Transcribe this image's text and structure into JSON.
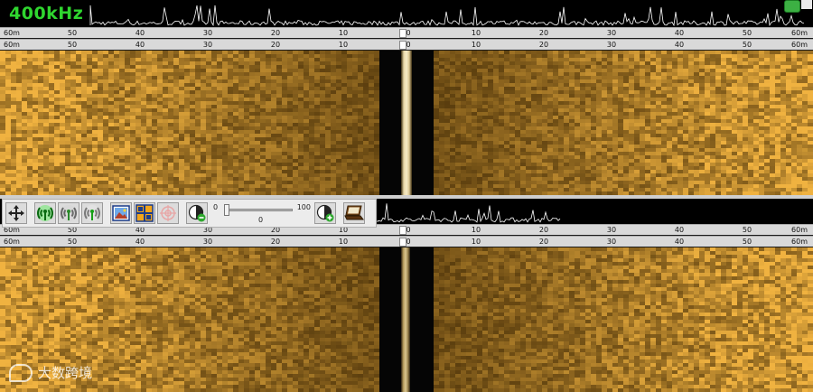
{
  "header": {
    "frequency": "400kHz"
  },
  "ruler": {
    "ticks": [
      "60m",
      "50",
      "40",
      "30",
      "20",
      "10",
      "0",
      "10",
      "20",
      "30",
      "40",
      "50",
      "60m"
    ]
  },
  "toolbar": {
    "slider": {
      "min": "0",
      "max": "100",
      "value": "0",
      "fraction": 0.0
    },
    "buttons": [
      {
        "name": "pan-button",
        "icon": "move-arrows-icon"
      },
      {
        "name": "signal-green-button",
        "icon": "broadcast-green-icon"
      },
      {
        "name": "signal-gray-button",
        "icon": "broadcast-gray-icon"
      },
      {
        "name": "signal-green-small-button",
        "icon": "broadcast-green-small-icon"
      },
      {
        "name": "picture-button",
        "icon": "image-icon"
      },
      {
        "name": "grid-button",
        "icon": "grid-icon"
      },
      {
        "name": "target-button",
        "icon": "crosshair-icon"
      },
      {
        "name": "contrast-decrease-button",
        "icon": "contrast-minus-icon"
      },
      {
        "name": "contrast-increase-button",
        "icon": "contrast-plus-icon"
      },
      {
        "name": "laptop-button",
        "icon": "laptop-icon"
      }
    ]
  },
  "watermark": {
    "text": "大数跨境"
  },
  "colors": {
    "sonar_bright": "#e8b64a",
    "sonar_dark": "#3a2604",
    "trace_line": "#ffffff",
    "freq_green": "#2fd62f"
  }
}
